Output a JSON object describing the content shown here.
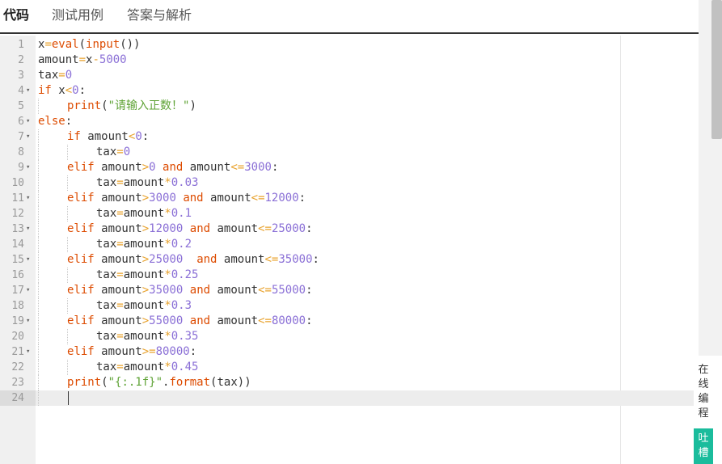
{
  "tabs": [
    {
      "label": "代码",
      "active": true
    },
    {
      "label": "测试用例",
      "active": false
    },
    {
      "label": "答案与解析",
      "active": false
    }
  ],
  "colors": {
    "keyword": "#dd4b00",
    "operator": "#e8a22c",
    "number": "#8a6fd6",
    "string": "#5fa336",
    "builtin": "#dd4b00",
    "text": "#333333",
    "feedback_bg": "#1abc9c"
  },
  "editor": {
    "active_line": 24,
    "lines": [
      {
        "n": "1",
        "fold": false,
        "indent": 0,
        "code": [
          [
            "t",
            "x"
          ],
          [
            "o",
            "="
          ],
          [
            "b",
            "eval"
          ],
          [
            "t",
            "("
          ],
          [
            "b",
            "input"
          ],
          [
            "t",
            "())"
          ]
        ]
      },
      {
        "n": "2",
        "fold": false,
        "indent": 0,
        "code": [
          [
            "t",
            "amount"
          ],
          [
            "o",
            "="
          ],
          [
            "t",
            "x"
          ],
          [
            "o",
            "-"
          ],
          [
            "n",
            "5000"
          ]
        ]
      },
      {
        "n": "3",
        "fold": false,
        "indent": 0,
        "code": [
          [
            "t",
            "tax"
          ],
          [
            "o",
            "="
          ],
          [
            "n",
            "0"
          ]
        ]
      },
      {
        "n": "4",
        "fold": true,
        "indent": 0,
        "code": [
          [
            "k",
            "if"
          ],
          [
            "t",
            " x"
          ],
          [
            "o",
            "<"
          ],
          [
            "n",
            "0"
          ],
          [
            "t",
            ":"
          ]
        ]
      },
      {
        "n": "5",
        "fold": false,
        "indent": 1,
        "code": [
          [
            "b",
            "print"
          ],
          [
            "t",
            "("
          ],
          [
            "s",
            "\"请输入正数！\""
          ],
          [
            "t",
            ")"
          ]
        ]
      },
      {
        "n": "6",
        "fold": true,
        "indent": 0,
        "code": [
          [
            "k",
            "else"
          ],
          [
            "t",
            ":"
          ]
        ]
      },
      {
        "n": "7",
        "fold": true,
        "indent": 1,
        "code": [
          [
            "k",
            "if"
          ],
          [
            "t",
            " amount"
          ],
          [
            "o",
            "<"
          ],
          [
            "n",
            "0"
          ],
          [
            "t",
            ":"
          ]
        ]
      },
      {
        "n": "8",
        "fold": false,
        "indent": 2,
        "code": [
          [
            "t",
            "tax"
          ],
          [
            "o",
            "="
          ],
          [
            "n",
            "0"
          ]
        ]
      },
      {
        "n": "9",
        "fold": true,
        "indent": 1,
        "code": [
          [
            "k",
            "elif"
          ],
          [
            "t",
            " amount"
          ],
          [
            "o",
            ">"
          ],
          [
            "n",
            "0"
          ],
          [
            "t",
            " "
          ],
          [
            "k",
            "and"
          ],
          [
            "t",
            " amount"
          ],
          [
            "o",
            "<="
          ],
          [
            "n",
            "3000"
          ],
          [
            "t",
            ":"
          ]
        ]
      },
      {
        "n": "10",
        "fold": false,
        "indent": 2,
        "code": [
          [
            "t",
            "tax"
          ],
          [
            "o",
            "="
          ],
          [
            "t",
            "amount"
          ],
          [
            "o",
            "*"
          ],
          [
            "n",
            "0.03"
          ]
        ]
      },
      {
        "n": "11",
        "fold": true,
        "indent": 1,
        "code": [
          [
            "k",
            "elif"
          ],
          [
            "t",
            " amount"
          ],
          [
            "o",
            ">"
          ],
          [
            "n",
            "3000"
          ],
          [
            "t",
            " "
          ],
          [
            "k",
            "and"
          ],
          [
            "t",
            " amount"
          ],
          [
            "o",
            "<="
          ],
          [
            "n",
            "12000"
          ],
          [
            "t",
            ":"
          ]
        ]
      },
      {
        "n": "12",
        "fold": false,
        "indent": 2,
        "code": [
          [
            "t",
            "tax"
          ],
          [
            "o",
            "="
          ],
          [
            "t",
            "amount"
          ],
          [
            "o",
            "*"
          ],
          [
            "n",
            "0.1"
          ]
        ]
      },
      {
        "n": "13",
        "fold": true,
        "indent": 1,
        "code": [
          [
            "k",
            "elif"
          ],
          [
            "t",
            " amount"
          ],
          [
            "o",
            ">"
          ],
          [
            "n",
            "12000"
          ],
          [
            "t",
            " "
          ],
          [
            "k",
            "and"
          ],
          [
            "t",
            " amount"
          ],
          [
            "o",
            "<="
          ],
          [
            "n",
            "25000"
          ],
          [
            "t",
            ":"
          ]
        ]
      },
      {
        "n": "14",
        "fold": false,
        "indent": 2,
        "code": [
          [
            "t",
            "tax"
          ],
          [
            "o",
            "="
          ],
          [
            "t",
            "amount"
          ],
          [
            "o",
            "*"
          ],
          [
            "n",
            "0.2"
          ]
        ]
      },
      {
        "n": "15",
        "fold": true,
        "indent": 1,
        "code": [
          [
            "k",
            "elif"
          ],
          [
            "t",
            " amount"
          ],
          [
            "o",
            ">"
          ],
          [
            "n",
            "25000"
          ],
          [
            "t",
            "  "
          ],
          [
            "k",
            "and"
          ],
          [
            "t",
            " amount"
          ],
          [
            "o",
            "<="
          ],
          [
            "n",
            "35000"
          ],
          [
            "t",
            ":"
          ]
        ]
      },
      {
        "n": "16",
        "fold": false,
        "indent": 2,
        "code": [
          [
            "t",
            "tax"
          ],
          [
            "o",
            "="
          ],
          [
            "t",
            "amount"
          ],
          [
            "o",
            "*"
          ],
          [
            "n",
            "0.25"
          ]
        ]
      },
      {
        "n": "17",
        "fold": true,
        "indent": 1,
        "code": [
          [
            "k",
            "elif"
          ],
          [
            "t",
            " amount"
          ],
          [
            "o",
            ">"
          ],
          [
            "n",
            "35000"
          ],
          [
            "t",
            " "
          ],
          [
            "k",
            "and"
          ],
          [
            "t",
            " amount"
          ],
          [
            "o",
            "<="
          ],
          [
            "n",
            "55000"
          ],
          [
            "t",
            ":"
          ]
        ]
      },
      {
        "n": "18",
        "fold": false,
        "indent": 2,
        "code": [
          [
            "t",
            "tax"
          ],
          [
            "o",
            "="
          ],
          [
            "t",
            "amount"
          ],
          [
            "o",
            "*"
          ],
          [
            "n",
            "0.3"
          ]
        ]
      },
      {
        "n": "19",
        "fold": true,
        "indent": 1,
        "code": [
          [
            "k",
            "elif"
          ],
          [
            "t",
            " amount"
          ],
          [
            "o",
            ">"
          ],
          [
            "n",
            "55000"
          ],
          [
            "t",
            " "
          ],
          [
            "k",
            "and"
          ],
          [
            "t",
            " amount"
          ],
          [
            "o",
            "<="
          ],
          [
            "n",
            "80000"
          ],
          [
            "t",
            ":"
          ]
        ]
      },
      {
        "n": "20",
        "fold": false,
        "indent": 2,
        "code": [
          [
            "t",
            "tax"
          ],
          [
            "o",
            "="
          ],
          [
            "t",
            "amount"
          ],
          [
            "o",
            "*"
          ],
          [
            "n",
            "0.35"
          ]
        ]
      },
      {
        "n": "21",
        "fold": true,
        "indent": 1,
        "code": [
          [
            "k",
            "elif"
          ],
          [
            "t",
            " amount"
          ],
          [
            "o",
            ">="
          ],
          [
            "n",
            "80000"
          ],
          [
            "t",
            ":"
          ]
        ]
      },
      {
        "n": "22",
        "fold": false,
        "indent": 2,
        "code": [
          [
            "t",
            "tax"
          ],
          [
            "o",
            "="
          ],
          [
            "t",
            "amount"
          ],
          [
            "o",
            "*"
          ],
          [
            "n",
            "0.45"
          ]
        ]
      },
      {
        "n": "23",
        "fold": false,
        "indent": 1,
        "code": [
          [
            "b",
            "print"
          ],
          [
            "t",
            "("
          ],
          [
            "s",
            "\"{:.1f}\""
          ],
          [
            "t",
            "."
          ],
          [
            "b",
            "format"
          ],
          [
            "t",
            "(tax))"
          ]
        ]
      },
      {
        "n": "24",
        "fold": false,
        "indent": 1,
        "code": []
      }
    ]
  },
  "side": {
    "online_label": [
      "在",
      "线",
      "编",
      "程"
    ],
    "feedback_label": [
      "吐",
      "槽"
    ]
  }
}
